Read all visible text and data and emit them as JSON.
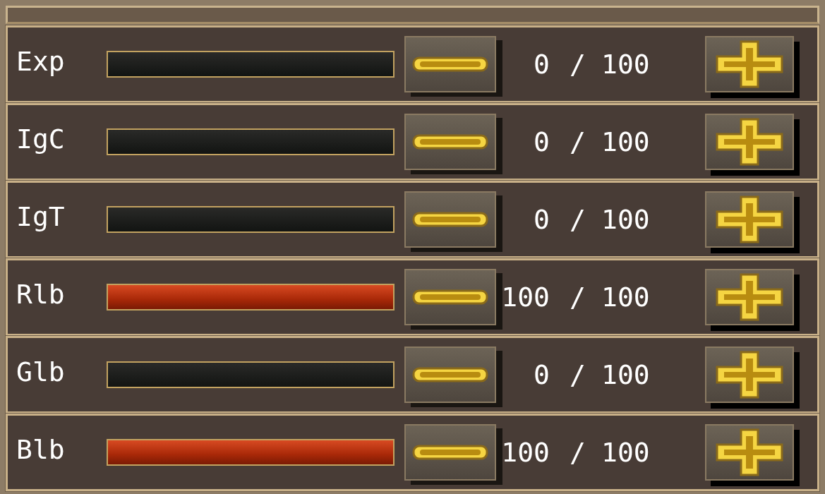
{
  "stats": [
    {
      "label": "Exp",
      "filled": false,
      "value": "0",
      "separator": "/",
      "max": "100"
    },
    {
      "label": "IgC",
      "filled": false,
      "value": "0",
      "separator": "/",
      "max": "100"
    },
    {
      "label": "IgT",
      "filled": false,
      "value": "0",
      "separator": "/",
      "max": "100"
    },
    {
      "label": "Rlb",
      "filled": true,
      "value": "100",
      "separator": "/",
      "max": "100"
    },
    {
      "label": "Glb",
      "filled": false,
      "value": "0",
      "separator": "/",
      "max": "100"
    },
    {
      "label": "Blb",
      "filled": true,
      "value": "100",
      "separator": "/",
      "max": "100"
    }
  ]
}
